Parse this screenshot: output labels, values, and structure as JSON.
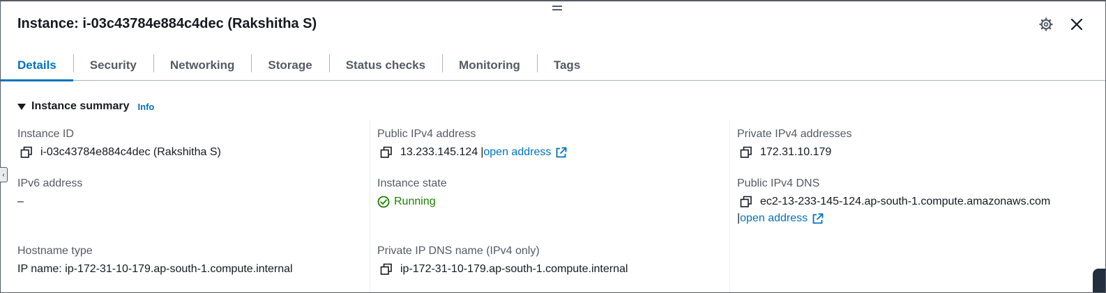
{
  "header": {
    "title": "Instance: i-03c43784e884c4dec (Rakshitha S)"
  },
  "tabs": [
    {
      "label": "Details",
      "active": true
    },
    {
      "label": "Security"
    },
    {
      "label": "Networking"
    },
    {
      "label": "Storage"
    },
    {
      "label": "Status checks"
    },
    {
      "label": "Monitoring"
    },
    {
      "label": "Tags"
    }
  ],
  "summary": {
    "title": "Instance summary",
    "info_label": "Info",
    "instance_id": {
      "label": "Instance ID",
      "value": "i-03c43784e884c4dec (Rakshitha S)"
    },
    "public_ipv4": {
      "label": "Public IPv4 address",
      "value": "13.233.145.124",
      "separator": "|",
      "link": "open address"
    },
    "private_ipv4": {
      "label": "Private IPv4 addresses",
      "value": "172.31.10.179"
    },
    "ipv6": {
      "label": "IPv6 address",
      "value": "–"
    },
    "state": {
      "label": "Instance state",
      "value": "Running"
    },
    "public_dns": {
      "label": "Public IPv4 DNS",
      "value": "ec2-13-233-145-124.ap-south-1.compute.amazonaws.com",
      "separator": "|",
      "link": "open address"
    },
    "hostname_type": {
      "label": "Hostname type",
      "value": "IP name: ip-172-31-10-179.ap-south-1.compute.internal"
    },
    "private_dns": {
      "label": "Private IP DNS name (IPv4 only)",
      "value": "ip-172-31-10-179.ap-south-1.compute.internal"
    }
  },
  "icons": {
    "settings": "gear-icon",
    "close": "close-icon",
    "copy": "copy-icon",
    "external": "external-link-icon",
    "status": "check-circle-icon"
  },
  "colors": {
    "accent": "#0073bb",
    "text": "#16191f",
    "label": "#545b64",
    "success": "#1d8102",
    "divider": "#aab7b8"
  }
}
